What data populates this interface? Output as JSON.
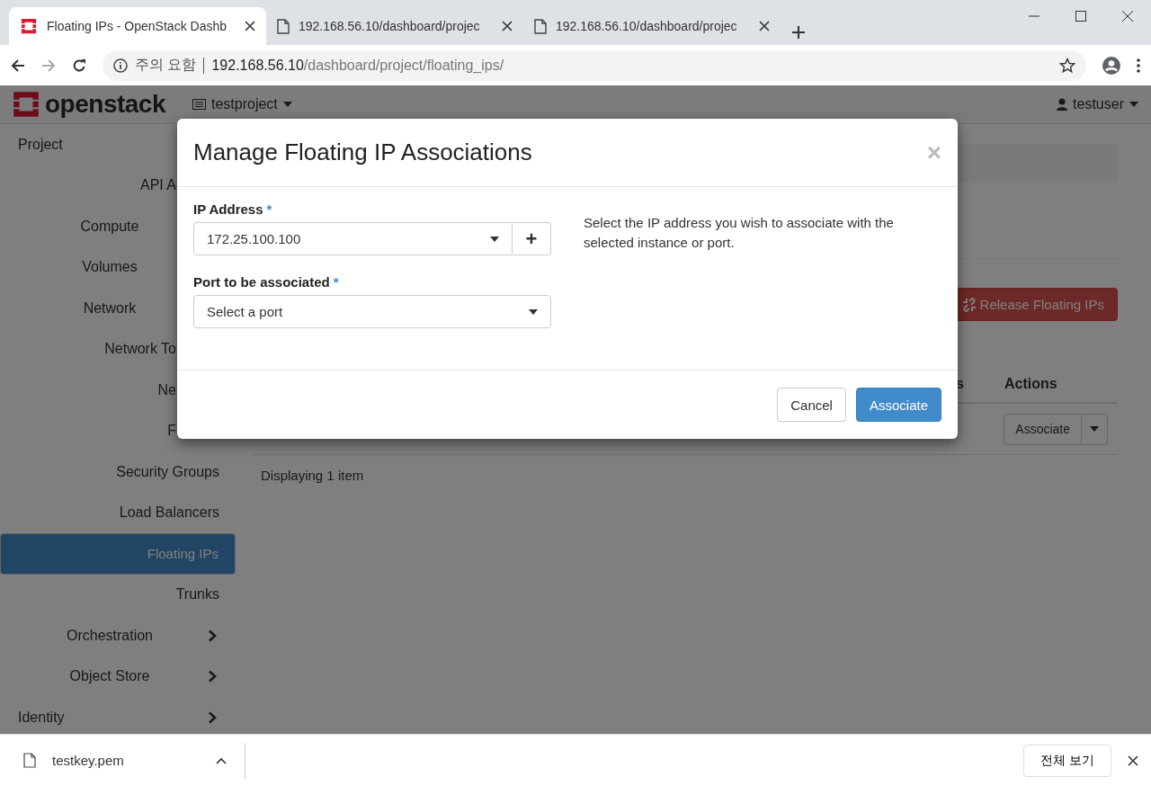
{
  "browser": {
    "tabs": [
      {
        "title": "Floating IPs - OpenStack Dashb",
        "selected": true
      },
      {
        "title": "192.168.56.10/dashboard/projec",
        "selected": false
      },
      {
        "title": "192.168.56.10/dashboard/projec",
        "selected": false
      }
    ],
    "security_label": "주의 요함",
    "url_host": "192.168.56.10",
    "url_path": "/dashboard/project/floating_ips/"
  },
  "navbar": {
    "logo": "openstack",
    "project": "testproject",
    "user": "testuser"
  },
  "sidebar": [
    {
      "label": "Project",
      "kind": "section",
      "children": [
        {
          "label": "API A",
          "kind": "partial"
        },
        {
          "label": "Compute",
          "kind": "group"
        },
        {
          "label": "Volumes",
          "kind": "group"
        },
        {
          "label": "Network",
          "kind": "group",
          "children": [
            {
              "label": "Network To",
              "kind": "partial-wide",
              "selected": false
            },
            {
              "label": "Ne",
              "kind": "partial",
              "selected": false
            },
            {
              "label": "F",
              "kind": "partial",
              "selected": false
            },
            {
              "label": "Security Groups",
              "kind": "item",
              "selected": false
            },
            {
              "label": "Load Balancers",
              "kind": "item",
              "selected": false
            },
            {
              "label": "Floating IPs",
              "kind": "item",
              "selected": true
            },
            {
              "label": "Trunks",
              "kind": "item",
              "selected": false
            }
          ]
        },
        {
          "label": "Orchestration",
          "kind": "group",
          "collapsed": true
        },
        {
          "label": "Object Store",
          "kind": "group",
          "collapsed": true
        }
      ]
    },
    {
      "label": "Identity",
      "kind": "section",
      "collapsed": true
    }
  ],
  "content": {
    "release_button": "Release Floating IPs",
    "table": {
      "columns": [
        "s",
        "Actions"
      ],
      "rows": [
        {
          "action": "Associate"
        }
      ]
    },
    "footer": "Displaying 1 item"
  },
  "modal": {
    "title": "Manage Floating IP Associations",
    "close": "×",
    "fields": [
      {
        "label": "IP Address",
        "required": true,
        "required_mark": "*",
        "value": "172.25.100.100",
        "kind": "select-add",
        "add": "+"
      },
      {
        "label": "Port to be associated",
        "required": true,
        "required_mark": "*",
        "value": "Select a port",
        "kind": "select"
      }
    ],
    "help": "Select the IP address you wish to associate with the selected instance or port.",
    "buttons": [
      {
        "label": "Cancel",
        "kind": "default"
      },
      {
        "label": "Associate",
        "kind": "primary"
      }
    ]
  },
  "downloads": {
    "file": "testkey.pem",
    "show_all": "전체 보기"
  }
}
